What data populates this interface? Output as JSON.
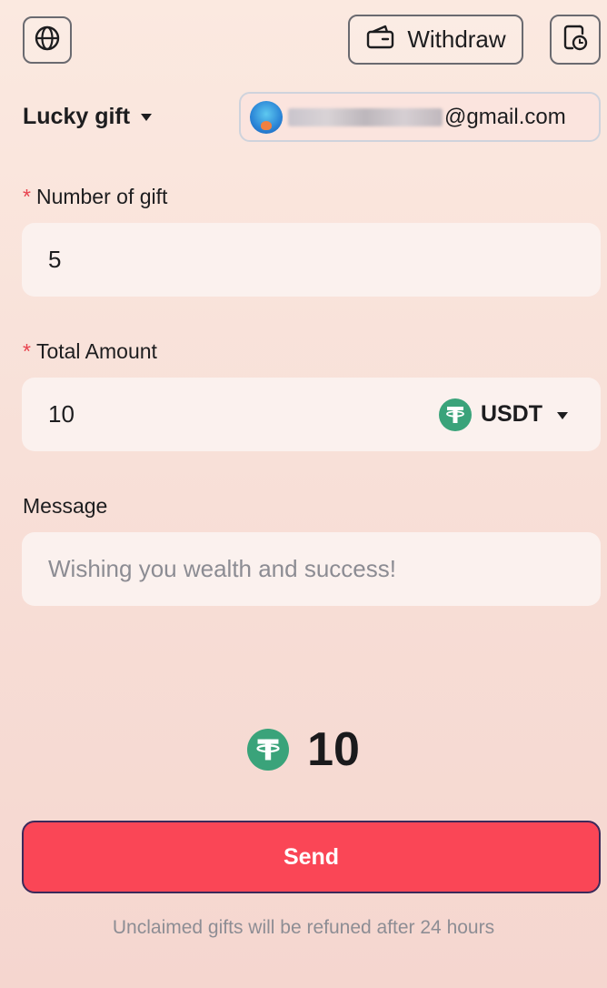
{
  "header": {
    "globe_icon": "globe-icon",
    "withdraw_label": "Withdraw",
    "withdraw_icon": "wallet-icon",
    "history_icon": "history-icon"
  },
  "gift_type": {
    "selected": "Lucky gift"
  },
  "account": {
    "email_suffix": "@gmail.com"
  },
  "form": {
    "number_of_gift": {
      "label": "Number of gift",
      "required_marker": "*",
      "value": "5"
    },
    "total_amount": {
      "label": "Total Amount",
      "required_marker": "*",
      "value": "10",
      "token": "USDT"
    },
    "message": {
      "label": "Message",
      "placeholder": "Wishing you wealth and success!"
    }
  },
  "summary": {
    "amount": "10",
    "token_icon": "tether-icon"
  },
  "send_button": {
    "label": "Send"
  },
  "footnote": "Unclaimed gifts will be refuned after 24 hours",
  "colors": {
    "accent": "#fa4656",
    "tether": "#3aa37a",
    "required": "#e8424e"
  }
}
